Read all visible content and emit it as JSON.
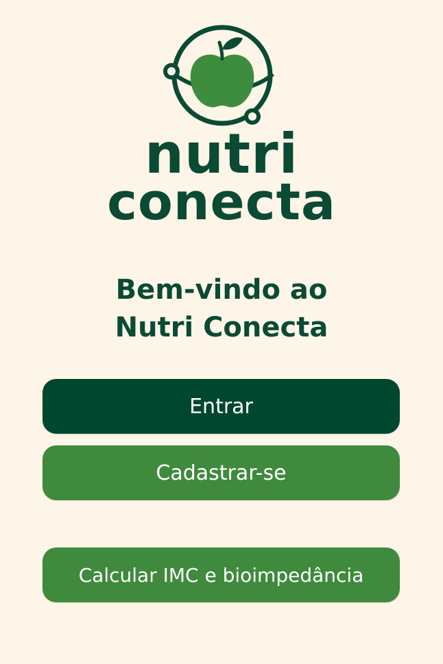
{
  "brand": {
    "wordmark_line1": "nutri",
    "wordmark_line2": "conecta",
    "primary_color": "#004730",
    "accent_color": "#3f8a3d",
    "background_color": "#fdf5e8",
    "logo_icon": "apple-orbit-icon"
  },
  "welcome": {
    "line1": "Bem-vindo ao",
    "line2": "Nutri Conecta"
  },
  "actions": {
    "login_label": "Entrar",
    "signup_label": "Cadastrar-se",
    "calculator_label": "Calcular IMC e bioimpedância"
  }
}
